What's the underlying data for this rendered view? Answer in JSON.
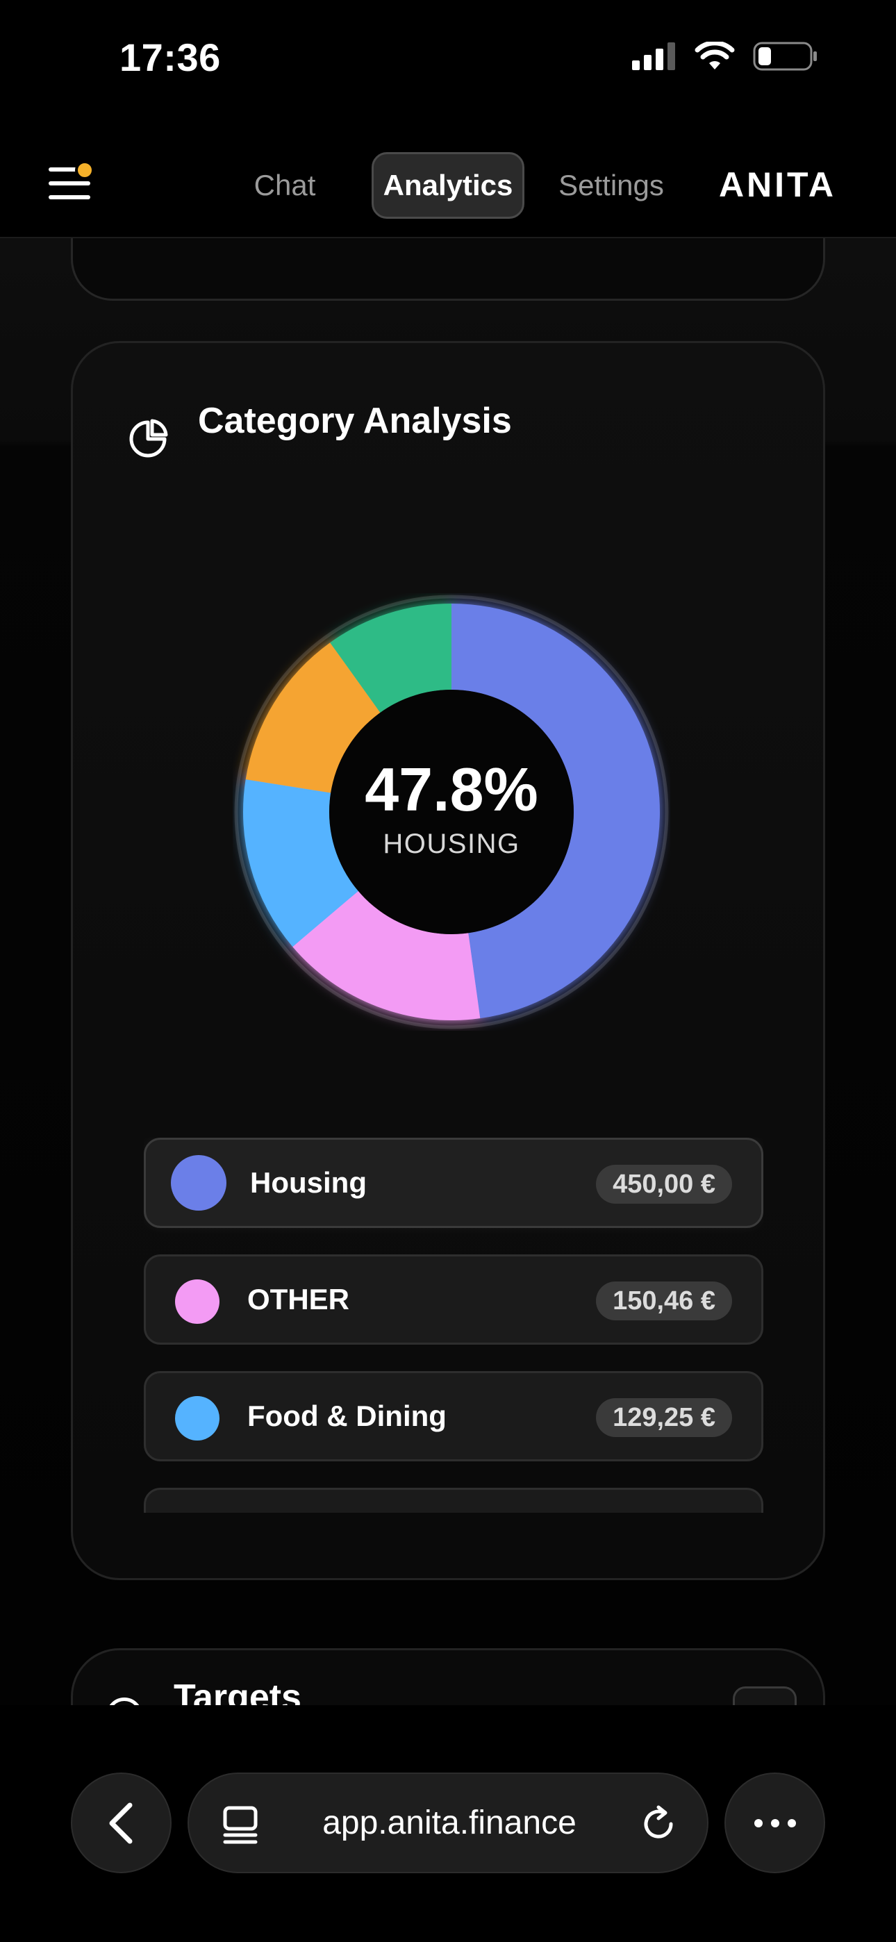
{
  "status": {
    "time": "17:36"
  },
  "nav": {
    "tabs": [
      {
        "label": "Chat",
        "active": false
      },
      {
        "label": "Analytics",
        "active": true
      },
      {
        "label": "Settings",
        "active": false
      }
    ],
    "brand": "ANITA",
    "notification_color": "#f5b12a"
  },
  "category_card": {
    "title": "Category Analysis",
    "icon": "pie-chart-icon",
    "center_value": "47.8%",
    "center_label": "HOUSING",
    "legend": [
      {
        "name": "Housing",
        "amount": "450,00 €",
        "color": "#6b7fe8",
        "active": true
      },
      {
        "name": "OTHER",
        "amount": "150,46 €",
        "color": "#f39bf4",
        "active": false
      },
      {
        "name": "Food & Dining",
        "amount": "129,25 €",
        "color": "#55b3ff",
        "active": false
      }
    ]
  },
  "chart_data": {
    "type": "pie",
    "variant": "donut",
    "categories": [
      "Housing",
      "OTHER",
      "Food & Dining",
      "Orange category",
      "Green category"
    ],
    "values": [
      47.8,
      16.0,
      13.7,
      12.6,
      9.9
    ],
    "colors": [
      "#6b7fe8",
      "#f39bf4",
      "#55b3ff",
      "#f5a431",
      "#2fbb86"
    ],
    "annotations": [
      "47.8%",
      "HOUSING"
    ]
  },
  "targets_card": {
    "title": "Targets"
  },
  "browser": {
    "url": "app.anita.finance"
  }
}
